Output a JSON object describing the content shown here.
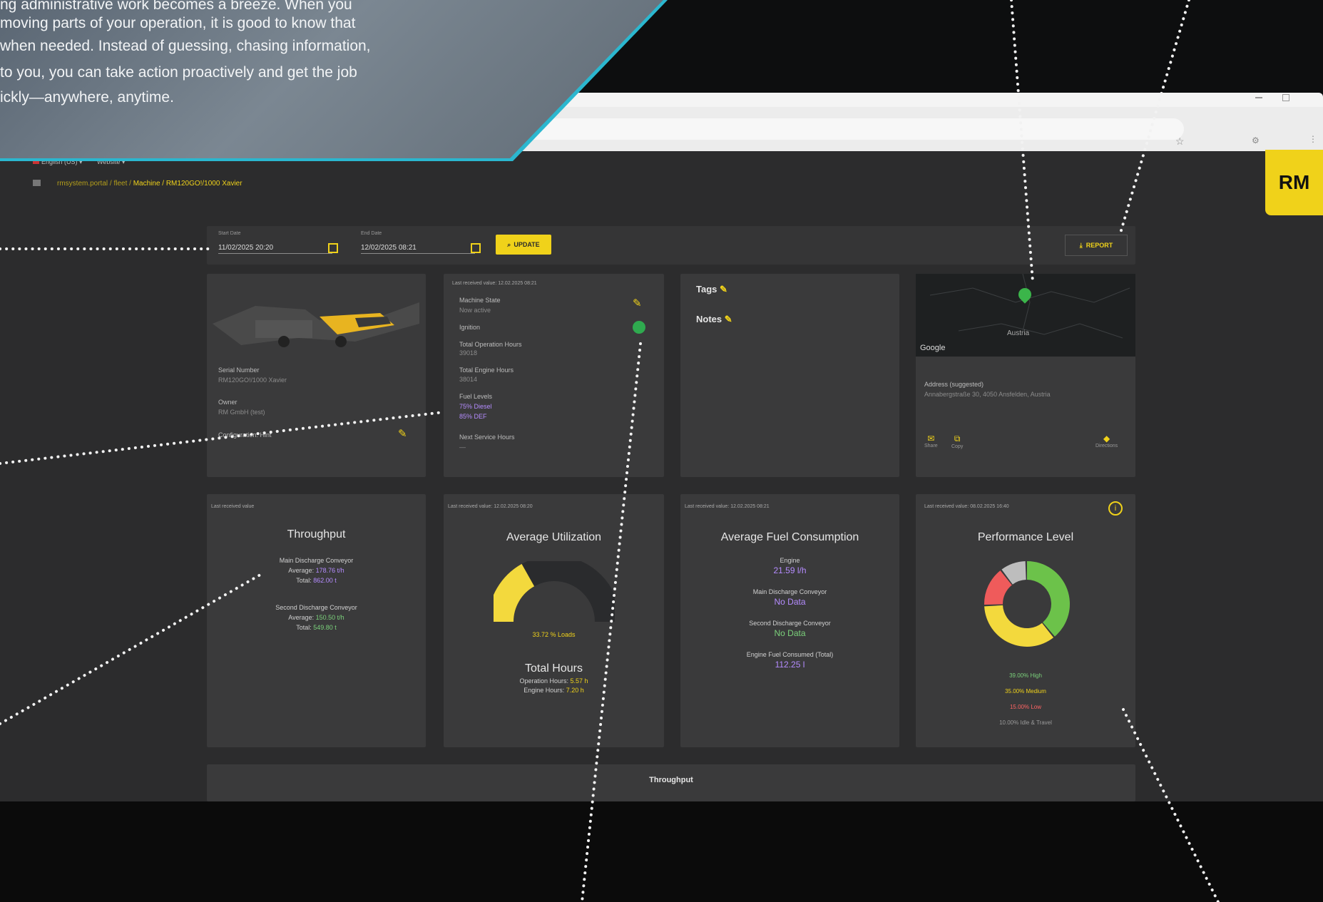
{
  "banner": {
    "lines": [
      "ng administrative work becomes a breeze. When you",
      " moving parts of your operation, it is good to know that",
      "when needed. Instead of guessing, chasing information,",
      " to you, you can take action proactively and get the job",
      "ickly—anywhere, anytime."
    ]
  },
  "topbar": {
    "lang": "English (US) ▾",
    "user": "Website ▾"
  },
  "breadcrumb": {
    "path": "rmsystem.portal / fleet /",
    "current": "Machine / RM120GO!/1000 Xavier"
  },
  "logo": "RM",
  "filters": {
    "start_label": "Start Date",
    "start_value": "11/02/2025 20:20",
    "end_label": "End Date",
    "end_value": "12/02/2025 08:21",
    "update": "UPDATE",
    "report": "REPORT"
  },
  "machine": {
    "serial_label": "Serial Number",
    "serial_value": "RM120GO!/1000 Xavier",
    "owner_label": "Owner",
    "owner_value": "RM GmbH (test)",
    "config_label": "Configuration: Hint"
  },
  "status": {
    "last": "Last received value: 12.02.2025 08:21",
    "state_label": "Machine State",
    "state_value": "Now active",
    "ignition_label": "Ignition",
    "total_op_label": "Total Operation Hours",
    "total_op_value": "39018",
    "total_eng_label": "Total Engine Hours",
    "total_eng_value": "38014",
    "fuel_label": "Fuel Levels",
    "fuel_1": "75% Diesel",
    "fuel_2": "85% DEF",
    "service_label": "Next Service Hours",
    "service_value": "—"
  },
  "tags": {
    "tags_label": "Tags",
    "notes_label": "Notes"
  },
  "map": {
    "country": "Austria",
    "google": "Google",
    "address_label": "Address (suggested)",
    "address_value": "Annabergstraße 30, 4050 Ansfelden, Austria",
    "share": "Share",
    "copy": "Copy",
    "directions": "Directions"
  },
  "throughput": {
    "last": "Last received value",
    "title": "Throughput",
    "main_label": "Main Discharge Conveyor",
    "main_avg_label": "Average:",
    "main_avg_value": "178.76 t/h",
    "main_total_label": "Total:",
    "main_total_value": "862.00 t",
    "second_label": "Second Discharge Conveyor",
    "second_avg_label": "Average:",
    "second_avg_value": "150.50 t/h",
    "second_total_label": "Total:",
    "second_total_value": "549.80 t"
  },
  "utilization": {
    "last": "Last received value: 12.02.2025 08:20",
    "title": "Average Utilization",
    "value_label": "33.72 % Loads",
    "fraction": 0.3372,
    "hours_title": "Total Hours",
    "op_label": "Operation Hours:",
    "op_value": "5.57 h",
    "eng_label": "Engine Hours:",
    "eng_value": "7.20 h"
  },
  "fuel": {
    "last": "Last received value: 12.02.2025 08:21",
    "title": "Average Fuel Consumption",
    "engine_label": "Engine",
    "engine_value": "21.59 l/h",
    "main_label": "Main Discharge Conveyor",
    "main_value": "No Data",
    "second_label": "Second Discharge Conveyor",
    "second_value": "No Data",
    "total_label": "Engine Fuel Consumed (Total)",
    "total_value": "112.25 l"
  },
  "performance": {
    "last": "Last received value: 08.02.2025 16:40",
    "title": "Performance Level",
    "legend": [
      "39.00% High",
      "35.00% Medium",
      "15.00% Low",
      "10.00% Idle & Travel"
    ],
    "segments": [
      {
        "name": "High",
        "value": 39,
        "color": "#6cc24a"
      },
      {
        "name": "Medium",
        "value": 35,
        "color": "#f3d93d"
      },
      {
        "name": "Low",
        "value": 15,
        "color": "#ef5b5b"
      },
      {
        "name": "Idle & Travel",
        "value": 10,
        "color": "#bdbdbd"
      }
    ]
  },
  "bottom": {
    "title": "Throughput"
  },
  "colors": {
    "accent": "#f0d21a",
    "card": "#3a3a3b",
    "bg": "#2c2c2d",
    "line": "#2bb7cf"
  }
}
